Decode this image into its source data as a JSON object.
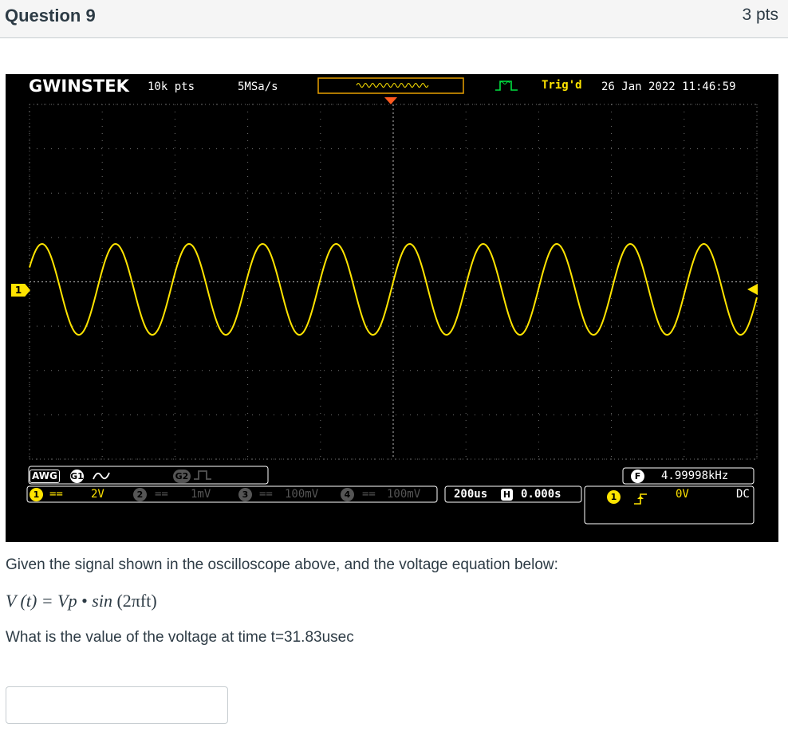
{
  "question": {
    "title": "Question 9",
    "points": "3 pts",
    "prompt": "Given the signal shown in the oscilloscope above, and the voltage equation below:",
    "equation": {
      "lhs": "V (t) = Vp",
      "bullet": "•",
      "fn": "sin",
      "arg": "(2πft)"
    },
    "question_text": "What is the value of the voltage at time t=31.83usec",
    "answer": {
      "value": "",
      "placeholder": ""
    }
  },
  "scope": {
    "brand": "GWINSTEK",
    "record_length": "10k pts",
    "sample_rate": "5MSa/s",
    "trigger_status": "Trig'd",
    "datetime": "26 Jan 2022 11:46:59",
    "channel_marker": "1",
    "awg": {
      "label": "AWG",
      "g1": "G1",
      "g2": "G2"
    },
    "channels": [
      {
        "id": "1",
        "coupling": "==",
        "scale": "2V",
        "active": true
      },
      {
        "id": "2",
        "coupling": "==",
        "scale": "1mV",
        "active": false
      },
      {
        "id": "3",
        "coupling": "==",
        "scale": "100mV",
        "active": false
      },
      {
        "id": "4",
        "coupling": "==",
        "scale": "100mV",
        "active": false
      }
    ],
    "timebase": {
      "scale": "200us",
      "h_label": "H",
      "position": "0.000s"
    },
    "frequency": {
      "label": "F",
      "value": "4.99998kHz"
    },
    "trigger": {
      "source": "1",
      "slope_icon": "rising-edge-icon",
      "level": "0V",
      "coupling": "DC"
    },
    "colors": {
      "channel1": "#ffe400",
      "trigger_arrow": "#ff5a1f",
      "background": "#000000"
    }
  }
}
